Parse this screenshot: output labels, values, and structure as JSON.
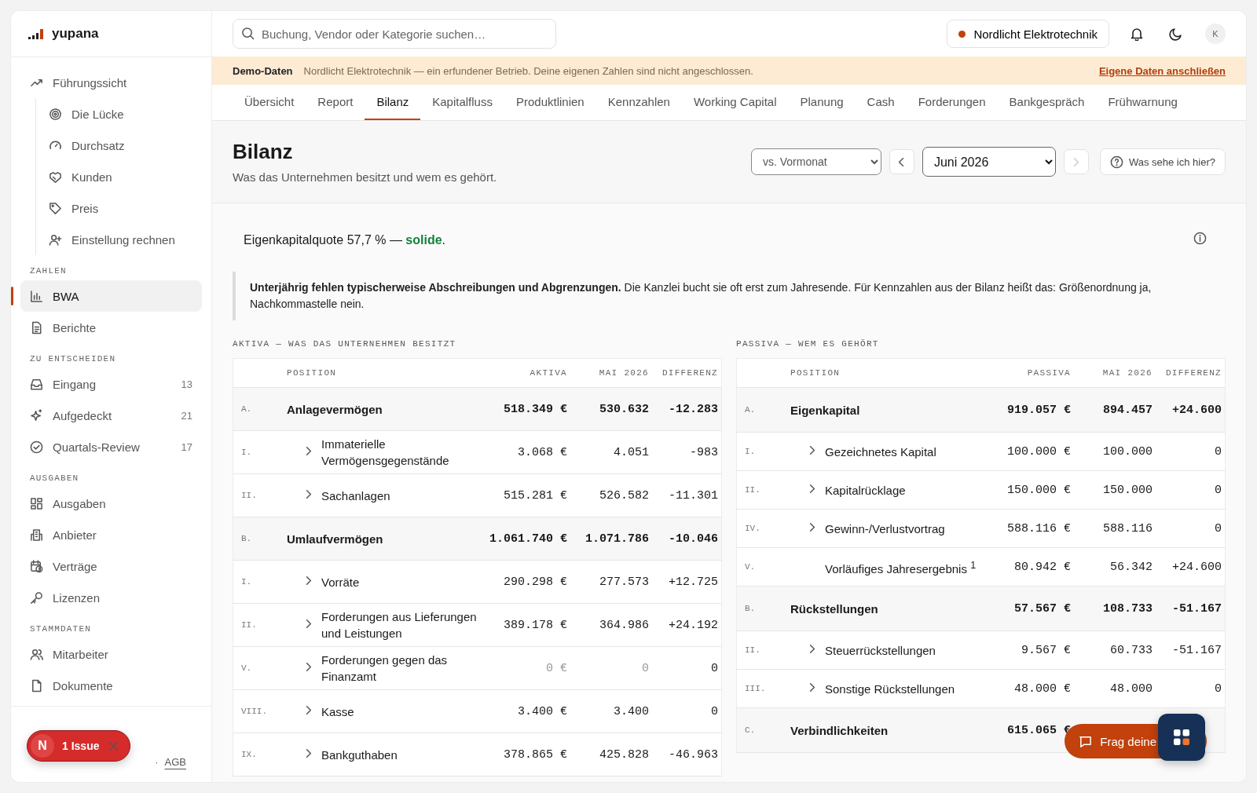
{
  "brand": {
    "name": "yupana"
  },
  "sidebar": {
    "items": [
      {
        "label": "Führungssicht",
        "selected": false,
        "children": [
          {
            "label": "Die Lücke",
            "selected": false
          },
          {
            "label": "Durchsatz",
            "selected": false
          },
          {
            "label": "Kunden",
            "selected": false
          },
          {
            "label": "Preis",
            "selected": false
          },
          {
            "label": "Einstellung rechnen",
            "selected": false
          }
        ]
      }
    ],
    "sections": [
      {
        "title": "ZAHLEN",
        "items": [
          {
            "label": "BWA",
            "selected": true
          },
          {
            "label": "Berichte",
            "selected": false
          }
        ]
      },
      {
        "title": "ZU ENTSCHEIDEN",
        "items": [
          {
            "label": "Eingang",
            "selected": false,
            "count": "13"
          },
          {
            "label": "Aufgedeckt",
            "selected": false,
            "count": "21"
          },
          {
            "label": "Quartals-Review",
            "selected": false,
            "count": "17"
          }
        ]
      },
      {
        "title": "AUSGABEN",
        "items": [
          {
            "label": "Ausgaben",
            "selected": false
          },
          {
            "label": "Anbieter",
            "selected": false
          },
          {
            "label": "Verträge",
            "selected": false
          },
          {
            "label": "Lizenzen",
            "selected": false
          }
        ]
      },
      {
        "title": "STAMMDATEN",
        "items": [
          {
            "label": "Mitarbeiter",
            "selected": false
          },
          {
            "label": "Dokumente",
            "selected": false
          }
        ]
      }
    ],
    "footer_separator": "·",
    "footer_links": [
      "AGB"
    ]
  },
  "search": {
    "placeholder": "Buchung, Vendor oder Kategorie suchen…"
  },
  "company": {
    "name": "Nordlicht Elektrotechnik",
    "color": "#c2410c"
  },
  "avatar": "K",
  "banner": {
    "label": "Demo-Daten",
    "text": "Nordlicht Elektrotechnik — ein erfundener Betrieb. Deine eigenen Zahlen sind nicht angeschlossen.",
    "link": "Eigene Daten anschließen"
  },
  "tabs": [
    {
      "label": "Übersicht",
      "selected": false
    },
    {
      "label": "Report",
      "selected": false
    },
    {
      "label": "Bilanz",
      "selected": true
    },
    {
      "label": "Kapitalfluss",
      "selected": false
    },
    {
      "label": "Produktlinien",
      "selected": false
    },
    {
      "label": "Kennzahlen",
      "selected": false
    },
    {
      "label": "Working Capital",
      "selected": false
    },
    {
      "label": "Planung",
      "selected": false
    },
    {
      "label": "Cash",
      "selected": false
    },
    {
      "label": "Forderungen",
      "selected": false
    },
    {
      "label": "Bankgespräch",
      "selected": false
    },
    {
      "label": "Frühwarnung",
      "selected": false
    }
  ],
  "page": {
    "title": "Bilanz",
    "subtitle": "Was das Unternehmen besitzt und wem es gehört.",
    "compare": "vs. Vormonat",
    "period": "Juni 2026",
    "next_disabled": true,
    "help": "Was sehe ich hier?"
  },
  "quote": "Eigenkapitalquote 57,7 % — **solide**.",
  "note": "**Unterjährig fehlen typischerweise Abschreibungen und Abgrenzungen.** Die Kanzlei bucht sie oft erst zum Jahresende. Für Kennzahlen aus der Bilanz heißt das: Größenordnung ja, Nachkommastelle nein.",
  "tables": [
    {
      "title": "AKTIVA — WAS DAS UNTERNEHMEN BESITZT",
      "columns": [
        "POSITION",
        "AKTIVA",
        "MAI 2026",
        "DIFFERENZ"
      ],
      "rows": [
        {
          "kind": "group",
          "num": "A.",
          "label": "Anlagevermögen",
          "value": "518.349 €",
          "prev": "530.632",
          "diff": "-12.283"
        },
        {
          "kind": "item",
          "num": "I.",
          "label": "Immaterielle Vermögensgegenstände",
          "value": "3.068 €",
          "prev": "4.051",
          "diff": "-983",
          "expandable": true,
          "dimmed": false
        },
        {
          "kind": "item",
          "num": "II.",
          "label": "Sachanlagen",
          "value": "515.281 €",
          "prev": "526.582",
          "diff": "-11.301",
          "expandable": true,
          "dimmed": false
        },
        {
          "kind": "group",
          "num": "B.",
          "label": "Umlaufvermögen",
          "value": "1.061.740 €",
          "prev": "1.071.786",
          "diff": "-10.046"
        },
        {
          "kind": "item",
          "num": "I.",
          "label": "Vorräte",
          "value": "290.298 €",
          "prev": "277.573",
          "diff": "+12.725",
          "expandable": true,
          "dimmed": false
        },
        {
          "kind": "item",
          "num": "II.",
          "label": "Forderungen aus Lieferungen und Leistungen",
          "value": "389.178 €",
          "prev": "364.986",
          "diff": "+24.192",
          "expandable": true,
          "dimmed": false
        },
        {
          "kind": "item",
          "num": "V.",
          "label": "Forderungen gegen das Finanzamt",
          "value": "0 €",
          "prev": "0",
          "diff": "0",
          "expandable": true,
          "dimmed": true
        },
        {
          "kind": "item",
          "num": "VIII.",
          "label": "Kasse",
          "value": "3.400 €",
          "prev": "3.400",
          "diff": "0",
          "expandable": true,
          "dimmed": false
        },
        {
          "kind": "item",
          "num": "IX.",
          "label": "Bankguthaben",
          "value": "378.865 €",
          "prev": "425.828",
          "diff": "-46.963",
          "expandable": true,
          "dimmed": false
        }
      ]
    },
    {
      "title": "PASSIVA — WEM ES GEHÖRT",
      "columns": [
        "POSITION",
        "PASSIVA",
        "MAI 2026",
        "DIFFERENZ"
      ],
      "rows": [
        {
          "kind": "group",
          "num": "A.",
          "label": "Eigenkapital",
          "value": "919.057 €",
          "prev": "894.457",
          "diff": "+24.600"
        },
        {
          "kind": "item",
          "num": "I.",
          "label": "Gezeichnetes Kapital",
          "value": "100.000 €",
          "prev": "100.000",
          "diff": "0",
          "expandable": true,
          "dimmed": false
        },
        {
          "kind": "item",
          "num": "II.",
          "label": "Kapitalrücklage",
          "value": "150.000 €",
          "prev": "150.000",
          "diff": "0",
          "expandable": true,
          "dimmed": false
        },
        {
          "kind": "item",
          "num": "IV.",
          "label": "Gewinn-/Verlustvortrag",
          "value": "588.116 €",
          "prev": "588.116",
          "diff": "0",
          "expandable": true,
          "dimmed": false
        },
        {
          "kind": "item",
          "num": "V.",
          "label": "Vorläufiges Jahresergebnis $^{1}$",
          "value": "80.942 €",
          "prev": "56.342",
          "diff": "+24.600",
          "expandable": false,
          "dimmed": false
        },
        {
          "kind": "group",
          "num": "B.",
          "label": "Rückstellungen",
          "value": "57.567 €",
          "prev": "108.733",
          "diff": "-51.167"
        },
        {
          "kind": "item",
          "num": "II.",
          "label": "Steuerrückstellungen",
          "value": "9.567 €",
          "prev": "60.733",
          "diff": "-51.167",
          "expandable": true,
          "dimmed": false
        },
        {
          "kind": "item",
          "num": "III.",
          "label": "Sonstige Rückstellungen",
          "value": "48.000 €",
          "prev": "48.000",
          "diff": "0",
          "expandable": true,
          "dimmed": false
        },
        {
          "kind": "group",
          "num": "C.",
          "label": "Verbindlichkeiten",
          "value": "615.065 €"
        }
      ]
    }
  ],
  "issue_badge": {
    "initial": "N",
    "label": "1 Issue"
  },
  "chat_button": {
    "label": "Frag deine"
  }
}
